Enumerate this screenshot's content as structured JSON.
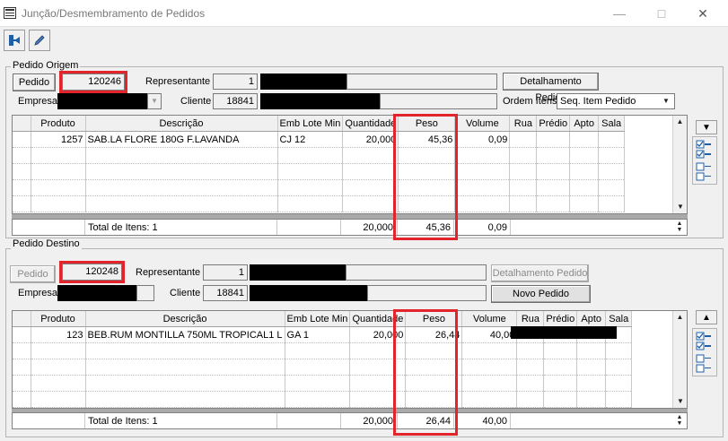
{
  "window": {
    "title": "Junção/Desmembramento de Pedidos"
  },
  "icons": {
    "exit": "exit-door-icon",
    "edit": "pencil-icon"
  },
  "accent_color": "#e3242b",
  "origem": {
    "group_label": "Pedido Origem",
    "pedido_button": "Pedido",
    "pedido_value": "120246",
    "representante_label": "Representante",
    "representante_value": "1",
    "detalhamento_button": "Detalhamento Pedido",
    "empresa_label": "Empresa",
    "cliente_label": "Cliente",
    "cliente_value": "18841",
    "ordem_label": "Ordem Itens",
    "ordem_value": "Seq. Item Pedido",
    "grid": {
      "headers": [
        "Produto",
        "Descrição",
        "Emb Lote Min",
        "Quantidade",
        "Peso",
        "Volume",
        "Rua",
        "Prédio",
        "Apto",
        "Sala"
      ],
      "rows": [
        [
          "1257",
          "SAB.LA FLORE 180G F.LAVANDA",
          "CJ 12",
          "20,000",
          "45,36",
          "0,09",
          "",
          "",
          "",
          ""
        ]
      ],
      "total_label": "Total de Itens: 1",
      "total_quantidade": "20,000",
      "total_peso": "45,36",
      "total_volume": "0,09"
    }
  },
  "destino": {
    "group_label": "Pedido Destino",
    "pedido_button": "Pedido",
    "pedido_value": "120248",
    "representante_label": "Representante",
    "representante_value": "1",
    "detalhamento_button": "Detalhamento Pedido",
    "novo_pedido_button": "Novo Pedido",
    "empresa_label": "Empresa",
    "cliente_label": "Cliente",
    "cliente_value": "18841",
    "grid": {
      "headers": [
        "Produto",
        "Descrição",
        "Emb Lote Min",
        "Quantidade",
        "Peso",
        "Volume",
        "Rua",
        "Prédio",
        "Apto",
        "Sala"
      ],
      "rows": [
        [
          "123",
          "BEB.RUM MONTILLA 750ML TROPICAL1 L",
          "GA 1",
          "20,000",
          "26,44",
          "40,00",
          "",
          "",
          "",
          ""
        ]
      ],
      "total_label": "Total de Itens: 1",
      "total_quantidade": "20,000",
      "total_peso": "26,44",
      "total_volume": "40,00"
    }
  }
}
